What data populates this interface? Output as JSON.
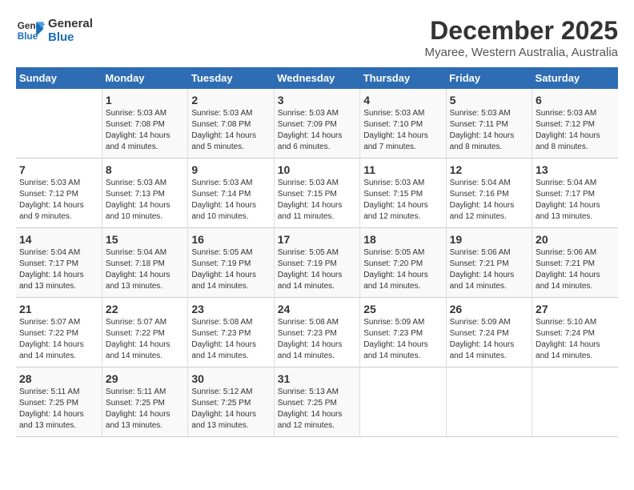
{
  "logo": {
    "line1": "General",
    "line2": "Blue"
  },
  "title": "December 2025",
  "subtitle": "Myaree, Western Australia, Australia",
  "headers": [
    "Sunday",
    "Monday",
    "Tuesday",
    "Wednesday",
    "Thursday",
    "Friday",
    "Saturday"
  ],
  "weeks": [
    [
      {
        "day": "",
        "info": ""
      },
      {
        "day": "1",
        "info": "Sunrise: 5:03 AM\nSunset: 7:08 PM\nDaylight: 14 hours\nand 4 minutes."
      },
      {
        "day": "2",
        "info": "Sunrise: 5:03 AM\nSunset: 7:08 PM\nDaylight: 14 hours\nand 5 minutes."
      },
      {
        "day": "3",
        "info": "Sunrise: 5:03 AM\nSunset: 7:09 PM\nDaylight: 14 hours\nand 6 minutes."
      },
      {
        "day": "4",
        "info": "Sunrise: 5:03 AM\nSunset: 7:10 PM\nDaylight: 14 hours\nand 7 minutes."
      },
      {
        "day": "5",
        "info": "Sunrise: 5:03 AM\nSunset: 7:11 PM\nDaylight: 14 hours\nand 8 minutes."
      },
      {
        "day": "6",
        "info": "Sunrise: 5:03 AM\nSunset: 7:12 PM\nDaylight: 14 hours\nand 8 minutes."
      }
    ],
    [
      {
        "day": "7",
        "info": "Sunrise: 5:03 AM\nSunset: 7:12 PM\nDaylight: 14 hours\nand 9 minutes."
      },
      {
        "day": "8",
        "info": "Sunrise: 5:03 AM\nSunset: 7:13 PM\nDaylight: 14 hours\nand 10 minutes."
      },
      {
        "day": "9",
        "info": "Sunrise: 5:03 AM\nSunset: 7:14 PM\nDaylight: 14 hours\nand 10 minutes."
      },
      {
        "day": "10",
        "info": "Sunrise: 5:03 AM\nSunset: 7:15 PM\nDaylight: 14 hours\nand 11 minutes."
      },
      {
        "day": "11",
        "info": "Sunrise: 5:03 AM\nSunset: 7:15 PM\nDaylight: 14 hours\nand 12 minutes."
      },
      {
        "day": "12",
        "info": "Sunrise: 5:04 AM\nSunset: 7:16 PM\nDaylight: 14 hours\nand 12 minutes."
      },
      {
        "day": "13",
        "info": "Sunrise: 5:04 AM\nSunset: 7:17 PM\nDaylight: 14 hours\nand 13 minutes."
      }
    ],
    [
      {
        "day": "14",
        "info": "Sunrise: 5:04 AM\nSunset: 7:17 PM\nDaylight: 14 hours\nand 13 minutes."
      },
      {
        "day": "15",
        "info": "Sunrise: 5:04 AM\nSunset: 7:18 PM\nDaylight: 14 hours\nand 13 minutes."
      },
      {
        "day": "16",
        "info": "Sunrise: 5:05 AM\nSunset: 7:19 PM\nDaylight: 14 hours\nand 14 minutes."
      },
      {
        "day": "17",
        "info": "Sunrise: 5:05 AM\nSunset: 7:19 PM\nDaylight: 14 hours\nand 14 minutes."
      },
      {
        "day": "18",
        "info": "Sunrise: 5:05 AM\nSunset: 7:20 PM\nDaylight: 14 hours\nand 14 minutes."
      },
      {
        "day": "19",
        "info": "Sunrise: 5:06 AM\nSunset: 7:21 PM\nDaylight: 14 hours\nand 14 minutes."
      },
      {
        "day": "20",
        "info": "Sunrise: 5:06 AM\nSunset: 7:21 PM\nDaylight: 14 hours\nand 14 minutes."
      }
    ],
    [
      {
        "day": "21",
        "info": "Sunrise: 5:07 AM\nSunset: 7:22 PM\nDaylight: 14 hours\nand 14 minutes."
      },
      {
        "day": "22",
        "info": "Sunrise: 5:07 AM\nSunset: 7:22 PM\nDaylight: 14 hours\nand 14 minutes."
      },
      {
        "day": "23",
        "info": "Sunrise: 5:08 AM\nSunset: 7:23 PM\nDaylight: 14 hours\nand 14 minutes."
      },
      {
        "day": "24",
        "info": "Sunrise: 5:08 AM\nSunset: 7:23 PM\nDaylight: 14 hours\nand 14 minutes."
      },
      {
        "day": "25",
        "info": "Sunrise: 5:09 AM\nSunset: 7:23 PM\nDaylight: 14 hours\nand 14 minutes."
      },
      {
        "day": "26",
        "info": "Sunrise: 5:09 AM\nSunset: 7:24 PM\nDaylight: 14 hours\nand 14 minutes."
      },
      {
        "day": "27",
        "info": "Sunrise: 5:10 AM\nSunset: 7:24 PM\nDaylight: 14 hours\nand 14 minutes."
      }
    ],
    [
      {
        "day": "28",
        "info": "Sunrise: 5:11 AM\nSunset: 7:25 PM\nDaylight: 14 hours\nand 13 minutes."
      },
      {
        "day": "29",
        "info": "Sunrise: 5:11 AM\nSunset: 7:25 PM\nDaylight: 14 hours\nand 13 minutes."
      },
      {
        "day": "30",
        "info": "Sunrise: 5:12 AM\nSunset: 7:25 PM\nDaylight: 14 hours\nand 13 minutes."
      },
      {
        "day": "31",
        "info": "Sunrise: 5:13 AM\nSunset: 7:25 PM\nDaylight: 14 hours\nand 12 minutes."
      },
      {
        "day": "",
        "info": ""
      },
      {
        "day": "",
        "info": ""
      },
      {
        "day": "",
        "info": ""
      }
    ]
  ]
}
